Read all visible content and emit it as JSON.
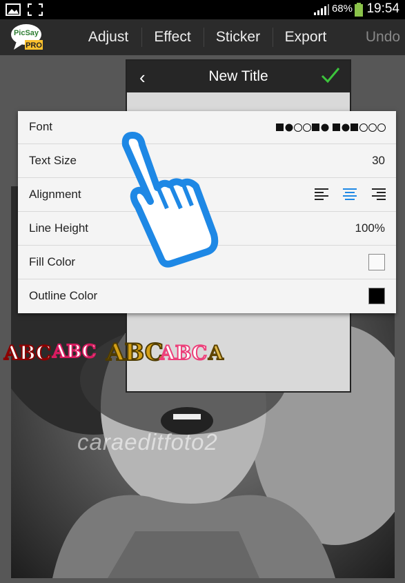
{
  "status_bar": {
    "battery": "68%",
    "time": "19:54",
    "icons": [
      "image-notification-icon",
      "screenshot-icon",
      "signal-icon",
      "battery-icon"
    ]
  },
  "toolbar": {
    "logo_text_top": "PicSay",
    "logo_text_bottom": "PRO",
    "items": [
      "Adjust",
      "Effect",
      "Sticker",
      "Export",
      "Undo"
    ]
  },
  "dialog": {
    "title": "New Title",
    "accent": "#3cc43c"
  },
  "menu": {
    "font_label": "Font",
    "font_preview_icons": [
      "linkedin-icon",
      "twitter-icon",
      "facebook-icon",
      "linkedin-circle-icon",
      "youtube-icon",
      "youtube-circle-icon",
      "linkedin-icon",
      "flickr-icon",
      "youtube-icon",
      "flickr-circle-icon",
      "googleplus-icon",
      "googleplus-circle-icon"
    ],
    "text_size_label": "Text Size",
    "text_size_value": "30",
    "alignment_label": "Alignment",
    "alignment_options": [
      "left-align-icon",
      "center-align-icon",
      "right-align-icon"
    ],
    "alignment_selected": "center",
    "line_height_label": "Line Height",
    "line_height_value": "100%",
    "fill_color_label": "Fill Color",
    "fill_color": "#ffffff",
    "outline_color_label": "Outline Color",
    "outline_color": "#000000"
  },
  "text_styles": [
    "ABC",
    "ABC",
    "ABC",
    "ABC",
    "A"
  ],
  "watermark": "caraeditfoto2",
  "accent_blue": "#1e88e5"
}
